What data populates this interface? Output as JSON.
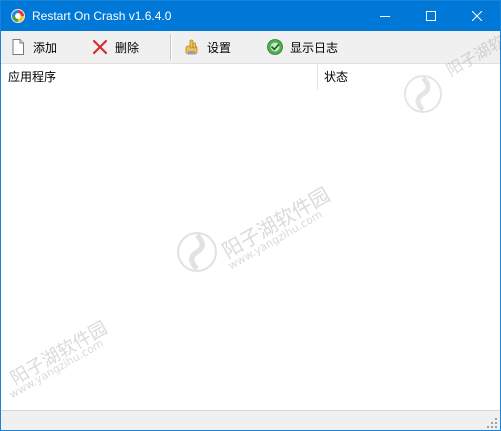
{
  "window": {
    "title": "Restart On Crash v1.6.4.0",
    "accent_color": "#0078d7"
  },
  "icons": {
    "app": "app-logo-icon",
    "minimize": "minimize-icon",
    "maximize": "maximize-icon",
    "close": "close-icon",
    "add": "document-icon",
    "delete": "red-x-icon",
    "settings": "hand-settings-icon",
    "log": "green-log-icon"
  },
  "toolbar": {
    "add_label": "添加",
    "delete_label": "删除",
    "settings_label": "设置",
    "log_label": "显示日志"
  },
  "list": {
    "columns": [
      "应用程序",
      "状态"
    ],
    "rows": []
  },
  "watermark": {
    "text_cn": "阳子湖软件园",
    "text_url": "www.yangzihu.com"
  }
}
